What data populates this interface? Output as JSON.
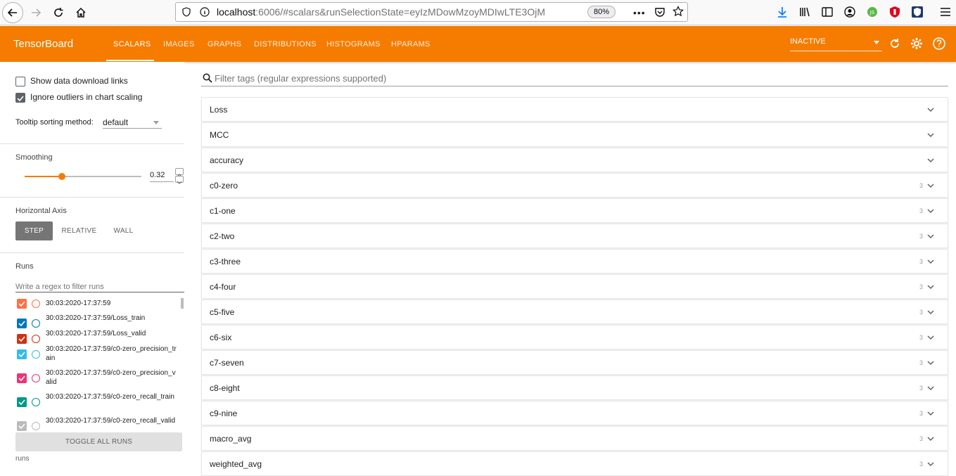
{
  "browser": {
    "url_host": "localhost",
    "url_rest": ":6006/#scalars&runSelectionState=eyIzMDowMzoyMDIwLTE3OjM",
    "zoom": "80%"
  },
  "header": {
    "title": "TensorBoard",
    "tabs": [
      "SCALARS",
      "IMAGES",
      "GRAPHS",
      "DISTRIBUTIONS",
      "HISTOGRAMS",
      "HPARAMS"
    ],
    "active_tab": "SCALARS",
    "status_select": "INACTIVE",
    "accent_color": "#f57c00"
  },
  "sidebar": {
    "show_download_links": "Show data download links",
    "ignore_outliers": "Ignore outliers in chart scaling",
    "tooltip_label": "Tooltip sorting method:",
    "tooltip_value": "default",
    "smoothing_label": "Smoothing",
    "smoothing_value": "0.32",
    "smoothing_fraction": 0.32,
    "horizontal_axis_label": "Horizontal Axis",
    "axis_options": [
      "STEP",
      "RELATIVE",
      "WALL"
    ],
    "axis_selected": "STEP",
    "runs_label": "Runs",
    "runs_filter_placeholder": "Write a regex to filter runs",
    "runs": [
      {
        "label": "30:03:2020-17:37:59",
        "color": "#ff7043"
      },
      {
        "label": "30:03:2020-17:37:59/Loss_train",
        "color": "#0077bb"
      },
      {
        "label": "30:03:2020-17:37:59/Loss_valid",
        "color": "#cc3311"
      },
      {
        "label": "30:03:2020-17:37:59/c0-zero_precision_train",
        "color": "#33bbee"
      },
      {
        "label": "30:03:2020-17:37:59/c0-zero_precision_valid",
        "color": "#ee3377"
      },
      {
        "label": "30:03:2020-17:37:59/c0-zero_recall_train",
        "color": "#009988"
      },
      {
        "label": "30:03:2020-17:37:59/c0-zero_recall_valid",
        "color": "#bbbbbb"
      }
    ],
    "toggle_all": "TOGGLE ALL RUNS",
    "footer": "runs"
  },
  "main": {
    "filter_placeholder": "Filter tags (regular expressions supported)",
    "categories": [
      {
        "name": "Loss",
        "count": ""
      },
      {
        "name": "MCC",
        "count": ""
      },
      {
        "name": "accuracy",
        "count": ""
      },
      {
        "name": "c0-zero",
        "count": "3"
      },
      {
        "name": "c1-one",
        "count": "3"
      },
      {
        "name": "c2-two",
        "count": "3"
      },
      {
        "name": "c3-three",
        "count": "3"
      },
      {
        "name": "c4-four",
        "count": "3"
      },
      {
        "name": "c5-five",
        "count": "3"
      },
      {
        "name": "c6-six",
        "count": "3"
      },
      {
        "name": "c7-seven",
        "count": "3"
      },
      {
        "name": "c8-eight",
        "count": "3"
      },
      {
        "name": "c9-nine",
        "count": "3"
      },
      {
        "name": "macro_avg",
        "count": "3"
      },
      {
        "name": "weighted_avg",
        "count": "3"
      }
    ]
  }
}
